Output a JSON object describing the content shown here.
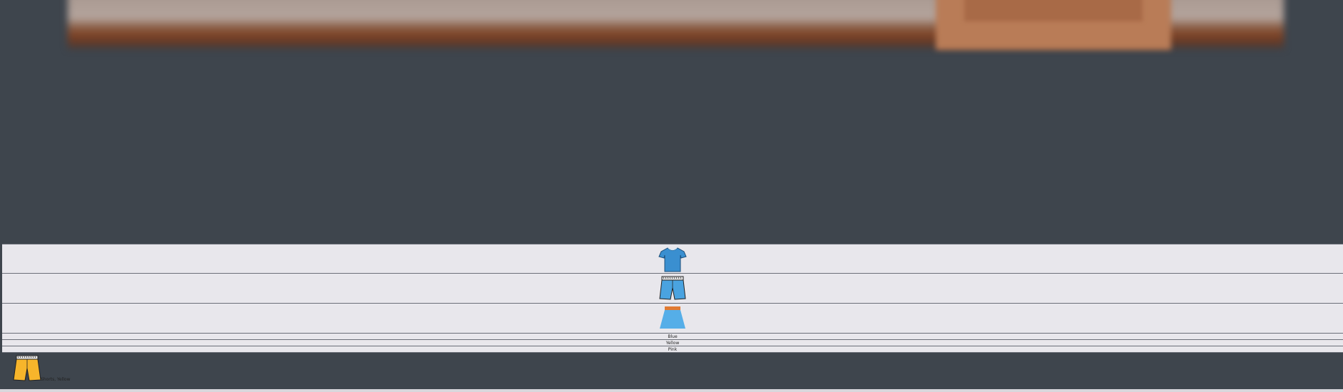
{
  "options": {
    "shirt_icon": "blue-tshirt-icon",
    "shorts_icon": "blue-shorts-icon",
    "skirt_icon": "blue-skirt-icon",
    "colors": [
      "Blue",
      "Yellow",
      "Pink"
    ]
  },
  "current": {
    "icon": "yellow-shorts-icon",
    "label": "Shorts, Yellow"
  },
  "palette": {
    "background": "#3e454d",
    "row": "#e8e7ec",
    "shirt_blue": "#3a8fd0",
    "shorts_blue": "#4aa3e0",
    "skirt_blue": "#55aee8",
    "skirt_waist": "#e07a32",
    "shorts_yellow": "#f7b52b"
  }
}
